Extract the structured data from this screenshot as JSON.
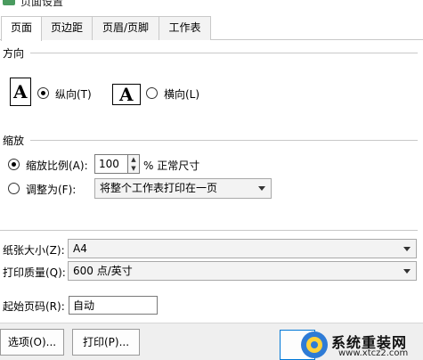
{
  "window": {
    "title": "页面设置"
  },
  "tabs": [
    {
      "label": "页面",
      "active": true
    },
    {
      "label": "页边距",
      "active": false
    },
    {
      "label": "页眉/页脚",
      "active": false
    },
    {
      "label": "工作表",
      "active": false
    }
  ],
  "orientation": {
    "section_label": "方向",
    "icon_glyph": "A",
    "portrait": {
      "label": "纵向(T)",
      "checked": true
    },
    "landscape": {
      "label": "横向(L)",
      "checked": false
    }
  },
  "scaling": {
    "section_label": "缩放",
    "adjust": {
      "label": "缩放比例(A):",
      "checked": true,
      "value": "100",
      "suffix": "% 正常尺寸"
    },
    "fit": {
      "label": "调整为(F):",
      "checked": false,
      "selected": "将整个工作表打印在一页"
    }
  },
  "paper": {
    "size": {
      "label": "纸张大小(Z):",
      "selected": "A4"
    },
    "quality": {
      "label": "打印质量(Q):",
      "selected": "600 点/英寸"
    },
    "first_page": {
      "label": "起始页码(R):",
      "value": "自动"
    }
  },
  "buttons": {
    "options": "选项(O)...",
    "print": "打印(P)..."
  },
  "watermark": {
    "name": "系统重装网",
    "url": "www.xtcz2.com"
  }
}
